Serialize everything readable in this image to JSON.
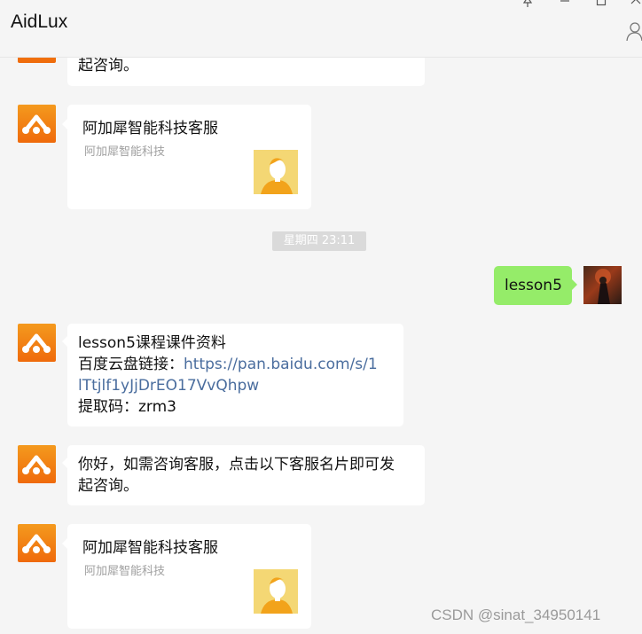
{
  "header": {
    "title": "AidLux"
  },
  "messages": {
    "m0_tail": "起咨询。",
    "card1": {
      "name": "阿加犀智能科技客服",
      "sub": "阿加犀智能科技"
    },
    "time": "星期四  23:11",
    "self_msg": "lesson5",
    "m3": {
      "line1": "lesson5课程课件资料",
      "line2_prefix": "百度云盘链接：",
      "line2_link": "https://pan.baidu.com/s/1",
      "line3_link": "lTtjlf1yJjDrEO17VvQhpw",
      "line4": "提取码：zrm3"
    },
    "m4": {
      "line1": "你好，如需咨询客服，点击以下客服名片即可发",
      "line2": "起咨询。"
    },
    "card2": {
      "name": "阿加犀智能科技客服",
      "sub": "阿加犀智能科技"
    }
  },
  "watermark": "CSDN @sinat_34950141",
  "icons": [
    "pin-icon",
    "minimize-icon",
    "maximize-icon",
    "close-icon",
    "person-icon",
    "aidlux-logo-icon"
  ],
  "colors": {
    "accent_orange": "#f4801a",
    "self_bubble": "#95ec69",
    "link": "#4a6d9e"
  }
}
